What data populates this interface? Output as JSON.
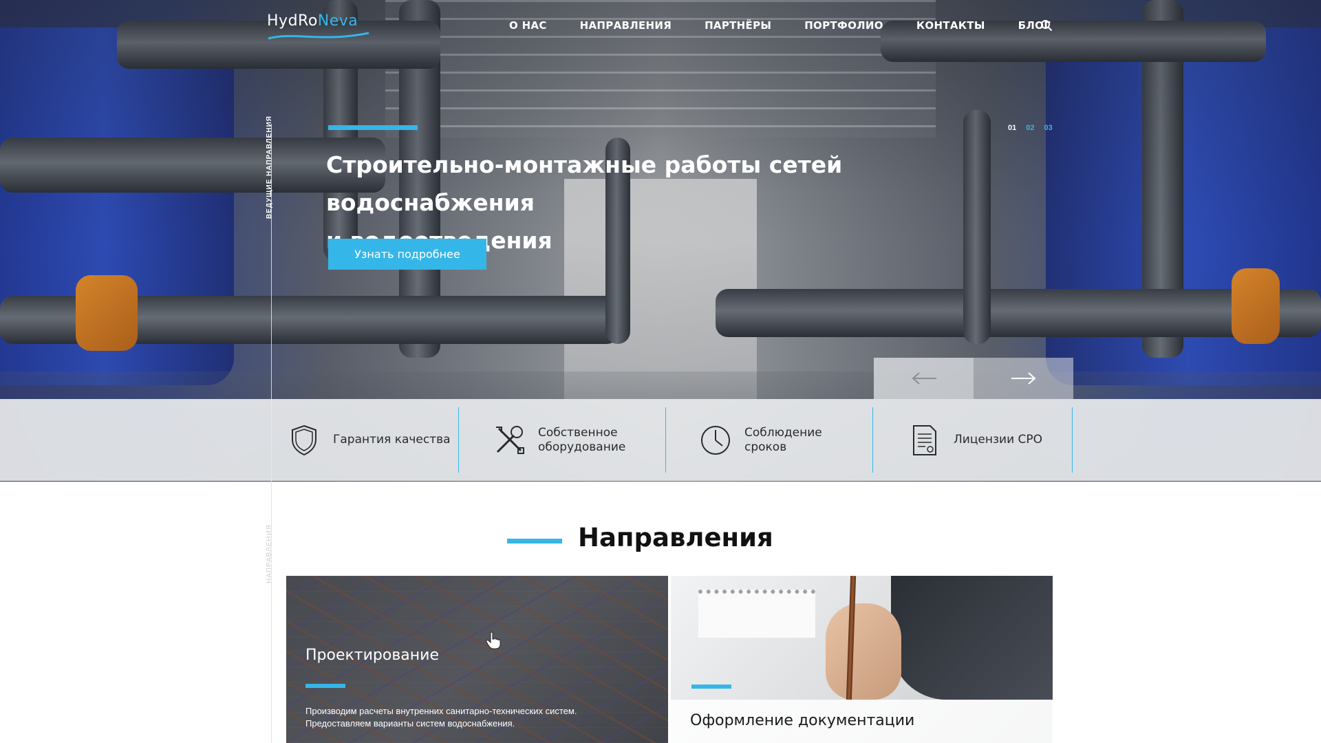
{
  "brand": {
    "logo_part1": "HydRo",
    "logo_part2": "Neva"
  },
  "nav": {
    "items": [
      {
        "label": "О НАС"
      },
      {
        "label": "НАПРАВЛЕНИЯ"
      },
      {
        "label": "ПАРТНЁРЫ"
      },
      {
        "label": "ПОРТФОЛИО"
      },
      {
        "label": "КОНТАКТЫ"
      },
      {
        "label": "БЛОГ"
      }
    ],
    "search_icon": "search-icon"
  },
  "hero": {
    "side_label": "ВЕДУЩИЕ НАПРАВЛЕНИЯ",
    "title_line1": "Строительно-монтажные работы сетей водоснабжения",
    "title_line2": "и водоотведения",
    "cta_label": "Узнать подробнее",
    "slides": [
      "01",
      "02",
      "03"
    ],
    "active_slide": "01"
  },
  "features": [
    {
      "icon": "shield-icon",
      "line1": "Гарантия качества",
      "line2": ""
    },
    {
      "icon": "tools-icon",
      "line1": "Собственное",
      "line2": "оборудование"
    },
    {
      "icon": "clock-icon",
      "line1": "Соблюдение",
      "line2": "сроков"
    },
    {
      "icon": "document-icon",
      "line1": "Лицензии СРО",
      "line2": ""
    }
  ],
  "section": {
    "side_label": "НАПРАВЛЕНИЯ",
    "title": "Направления"
  },
  "cards": [
    {
      "title": "Проектирование",
      "desc_line1": "Производим расчеты внутренних санитарно-технических систем.",
      "desc_line2": "Предоставляем варианты систем водоснабжения."
    },
    {
      "title": "Оформление документации"
    }
  ],
  "colors": {
    "accent": "#35b6e8",
    "text_dark": "#111111",
    "strip": "#e8eaed"
  }
}
